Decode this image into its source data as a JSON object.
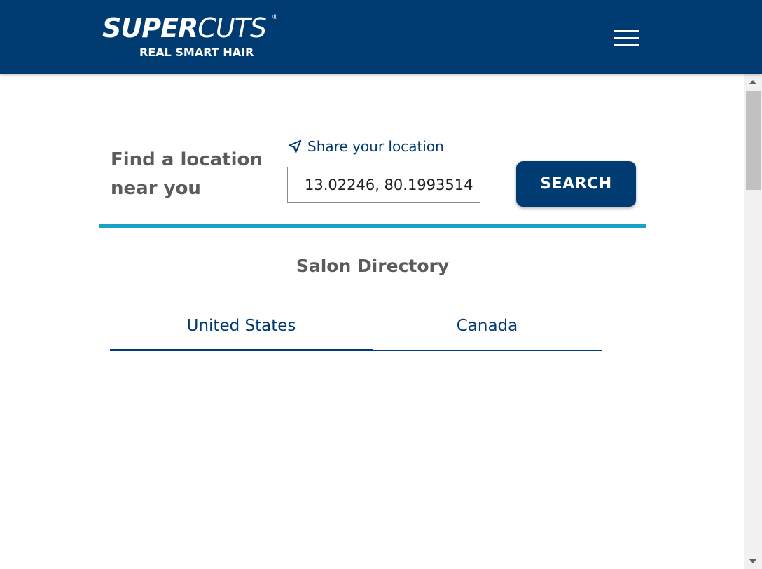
{
  "header": {
    "logo": {
      "brand_bold": "SUPER",
      "brand_light": "CUTS",
      "registered": "®",
      "tagline": "REAL SMART HAIR"
    },
    "menu_icon": "hamburger-menu-icon",
    "background_color": "#003b72"
  },
  "finder": {
    "title_line1": "Find a location",
    "title_line2": "near you",
    "share_location_label": "Share your location",
    "share_location_icon": "location-arrow-icon",
    "location_input_value": "13.02246, 80.1993514",
    "search_button_label": "SEARCH",
    "accent_color": "#1aa1c9"
  },
  "directory": {
    "title": "Salon Directory",
    "tabs": [
      {
        "label": "United States",
        "active": true
      },
      {
        "label": "Canada",
        "active": false
      }
    ]
  }
}
